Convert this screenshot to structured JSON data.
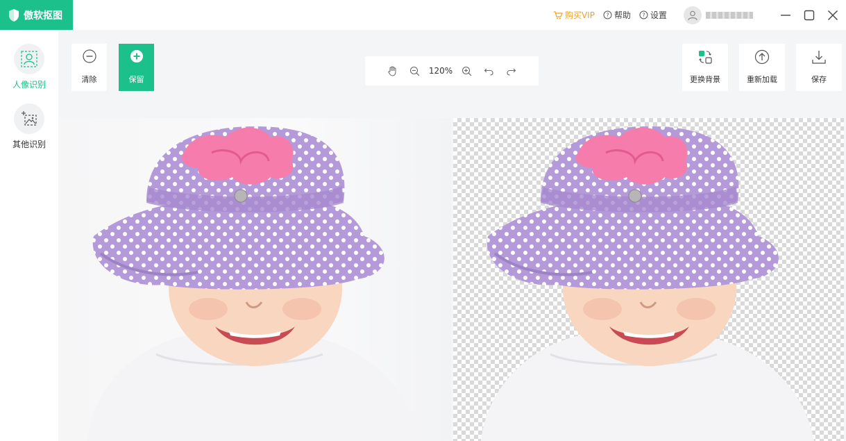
{
  "app": {
    "title": "傲软抠图"
  },
  "topbar": {
    "vip": "购买VIP",
    "help": "帮助",
    "settings": "设置"
  },
  "sidebar": {
    "items": [
      {
        "label": "人像识别",
        "active": true,
        "icon": "portrait-icon"
      },
      {
        "label": "其他识别",
        "active": false,
        "icon": "image-add-icon"
      }
    ]
  },
  "toolbar": {
    "clear_label": "清除",
    "keep_label": "保留",
    "zoom": "120%",
    "change_bg_label": "更换背景",
    "reload_label": "重新加载",
    "save_label": "保存"
  },
  "colors": {
    "accent": "#1bc08a",
    "vip": "#f0a020",
    "background": "#f4f5f7"
  }
}
